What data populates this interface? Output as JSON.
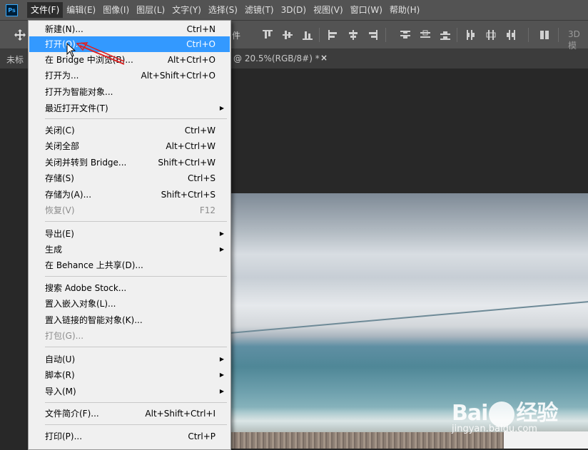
{
  "app": {
    "logo_text": "Ps"
  },
  "menubar": {
    "items": [
      "文件(F)",
      "编辑(E)",
      "图像(I)",
      "图层(L)",
      "文字(Y)",
      "选择(S)",
      "滤镜(T)",
      "3D(D)",
      "视图(V)",
      "窗口(W)",
      "帮助(H)"
    ],
    "active_index": 0
  },
  "optionsbar": {
    "partial_text": "件",
    "label_3d": "3D 模"
  },
  "tabs": {
    "left_tab": "未标",
    "doc_tab": "@ 20.5%(RGB/8#) *",
    "close_glyph": "×"
  },
  "file_menu": {
    "group1": [
      {
        "label": "新建(N)...",
        "shortcut": "Ctrl+N"
      },
      {
        "label": "打开(O)...",
        "shortcut": "Ctrl+O"
      },
      {
        "label": "在 Bridge 中浏览(B)...",
        "shortcut": "Alt+Ctrl+O"
      },
      {
        "label": "打开为...",
        "shortcut": "Alt+Shift+Ctrl+O"
      },
      {
        "label": "打开为智能对象...",
        "shortcut": ""
      },
      {
        "label": "最近打开文件(T)",
        "shortcut": ""
      }
    ],
    "group2": [
      {
        "label": "关闭(C)",
        "shortcut": "Ctrl+W"
      },
      {
        "label": "关闭全部",
        "shortcut": "Alt+Ctrl+W"
      },
      {
        "label": "关闭并转到 Bridge...",
        "shortcut": "Shift+Ctrl+W"
      },
      {
        "label": "存储(S)",
        "shortcut": "Ctrl+S"
      },
      {
        "label": "存储为(A)...",
        "shortcut": "Shift+Ctrl+S"
      },
      {
        "label": "恢复(V)",
        "shortcut": "F12"
      }
    ],
    "group3": [
      {
        "label": "导出(E)",
        "shortcut": ""
      },
      {
        "label": "生成",
        "shortcut": ""
      },
      {
        "label": "在 Behance 上共享(D)...",
        "shortcut": ""
      }
    ],
    "group4": [
      {
        "label": "搜索 Adobe Stock...",
        "shortcut": ""
      },
      {
        "label": "置入嵌入对象(L)...",
        "shortcut": ""
      },
      {
        "label": "置入链接的智能对象(K)...",
        "shortcut": ""
      },
      {
        "label": "打包(G)...",
        "shortcut": ""
      }
    ],
    "group5": [
      {
        "label": "自动(U)",
        "shortcut": ""
      },
      {
        "label": "脚本(R)",
        "shortcut": ""
      },
      {
        "label": "导入(M)",
        "shortcut": ""
      }
    ],
    "group6": [
      {
        "label": "文件简介(F)...",
        "shortcut": "Alt+Shift+Ctrl+I"
      }
    ],
    "group7": [
      {
        "label": "打印(P)...",
        "shortcut": "Ctrl+P"
      }
    ],
    "highlighted_item": "打开(O)...",
    "submenu_glyph": "▶"
  },
  "watermark": {
    "brand": "Bai",
    "brand2": "经验",
    "url": "jingyan.baidu.com"
  },
  "colors": {
    "highlight": "#3399ff",
    "annotation_arrow": "#e02020",
    "menubar_bg": "#535353"
  }
}
